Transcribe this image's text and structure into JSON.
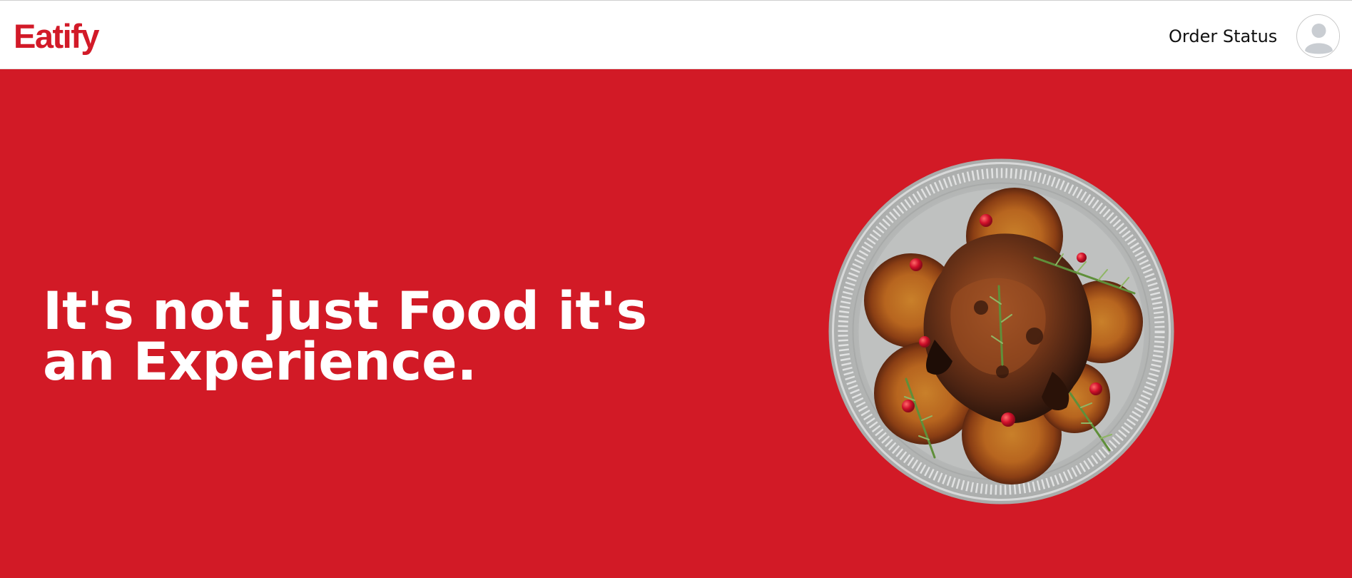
{
  "header": {
    "brand": "Eatify",
    "nav": {
      "order_status_label": "Order Status"
    },
    "avatar_icon": "user-avatar-icon"
  },
  "hero": {
    "headline": "It's not just Food it's an Experience.",
    "image_icon": "roast-chicken-plate",
    "background_color": "#d21a26"
  },
  "colors": {
    "brand": "#d21a28",
    "hero_background": "#d21a26",
    "header_background": "#ffffff",
    "text_dark": "#111111"
  }
}
